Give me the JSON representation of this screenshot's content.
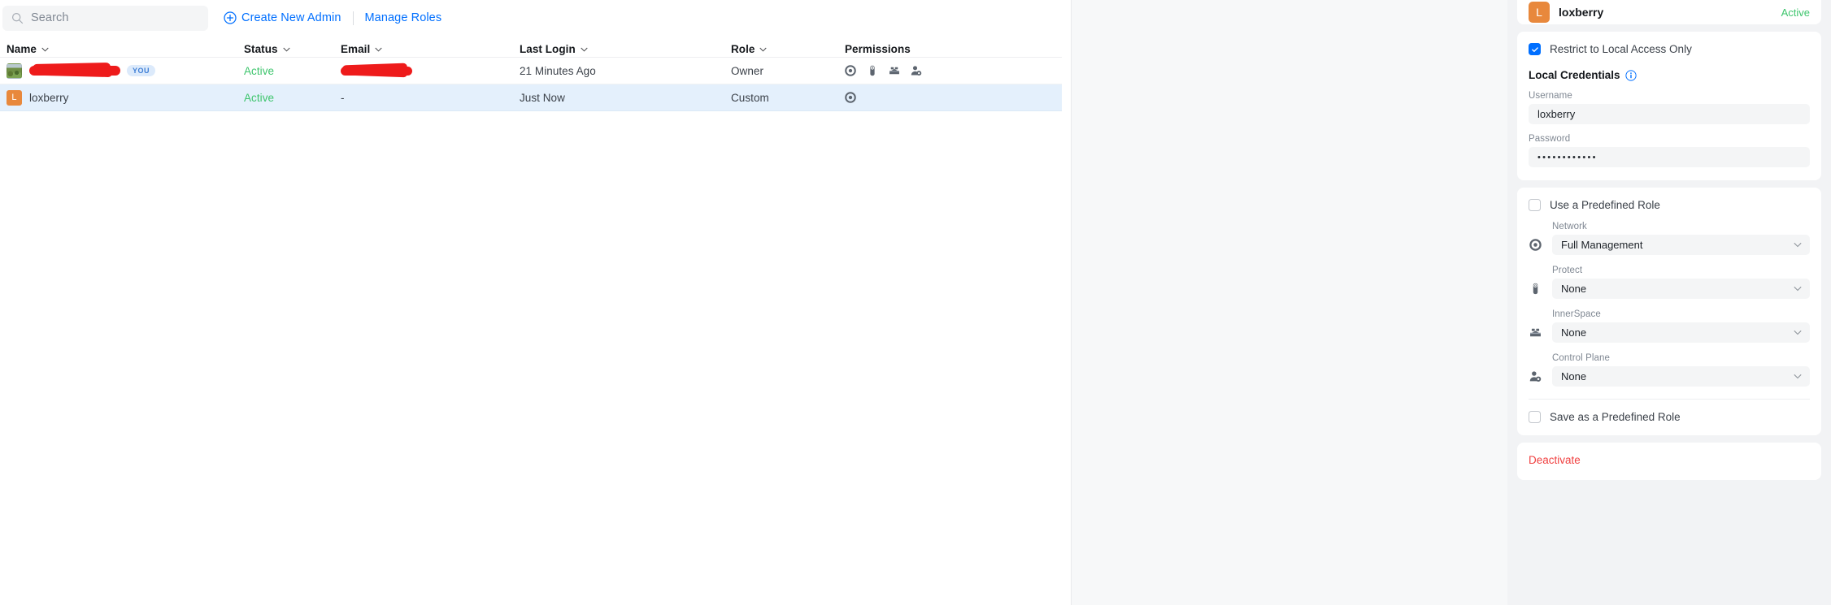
{
  "toolbar": {
    "search_placeholder": "Search",
    "create_label": "Create New Admin",
    "manage_roles_label": "Manage Roles"
  },
  "table": {
    "columns": [
      {
        "key": "name",
        "label": "Name",
        "sortable": true
      },
      {
        "key": "status",
        "label": "Status",
        "sortable": true
      },
      {
        "key": "email",
        "label": "Email",
        "sortable": true
      },
      {
        "key": "last_login",
        "label": "Last Login",
        "sortable": true
      },
      {
        "key": "role",
        "label": "Role",
        "sortable": true
      },
      {
        "key": "permissions",
        "label": "Permissions",
        "sortable": false
      }
    ],
    "rows": [
      {
        "avatar_type": "photo",
        "avatar_letter": "",
        "name": "",
        "name_redacted": true,
        "you_badge": "YOU",
        "status": "Active",
        "email": "",
        "email_redacted": true,
        "last_login": "21 Minutes Ago",
        "role": "Owner",
        "permissions": [
          "network-icon",
          "protect-icon",
          "innerspace-icon",
          "control-plane-icon"
        ],
        "selected": false
      },
      {
        "avatar_type": "letter",
        "avatar_letter": "L",
        "name": "loxberry",
        "name_redacted": false,
        "you_badge": "",
        "status": "Active",
        "email": "-",
        "email_redacted": false,
        "last_login": "Just Now",
        "role": "Custom",
        "permissions": [
          "network-icon"
        ],
        "selected": true
      }
    ]
  },
  "panel": {
    "header": {
      "avatar_letter": "L",
      "name": "loxberry",
      "status": "Active"
    },
    "restrict_local": {
      "label": "Restrict to Local Access Only",
      "checked": true
    },
    "credentials": {
      "section_title": "Local Credentials",
      "info_icon": "info-icon",
      "username_label": "Username",
      "username_value": "loxberry",
      "password_label": "Password",
      "password_value": "••••••••••••"
    },
    "predefined_role": {
      "label": "Use a Predefined Role",
      "checked": false
    },
    "permissions": [
      {
        "icon": "network-icon",
        "label": "Network",
        "value": "Full Management"
      },
      {
        "icon": "protect-icon",
        "label": "Protect",
        "value": "None"
      },
      {
        "icon": "innerspace-icon",
        "label": "InnerSpace",
        "value": "None"
      },
      {
        "icon": "control-plane-icon",
        "label": "Control Plane",
        "value": "None"
      }
    ],
    "save_role": {
      "label": "Save as a Predefined Role",
      "checked": false
    },
    "deactivate_label": "Deactivate"
  },
  "colors": {
    "accent_blue": "#006fff",
    "status_green": "#3ec56d",
    "danger_red": "#f04141",
    "avatar_orange": "#e8883c",
    "row_selected": "#e4f0fc",
    "badge_blue_bg": "#dceafb",
    "redaction_red": "#ee1b1b"
  }
}
